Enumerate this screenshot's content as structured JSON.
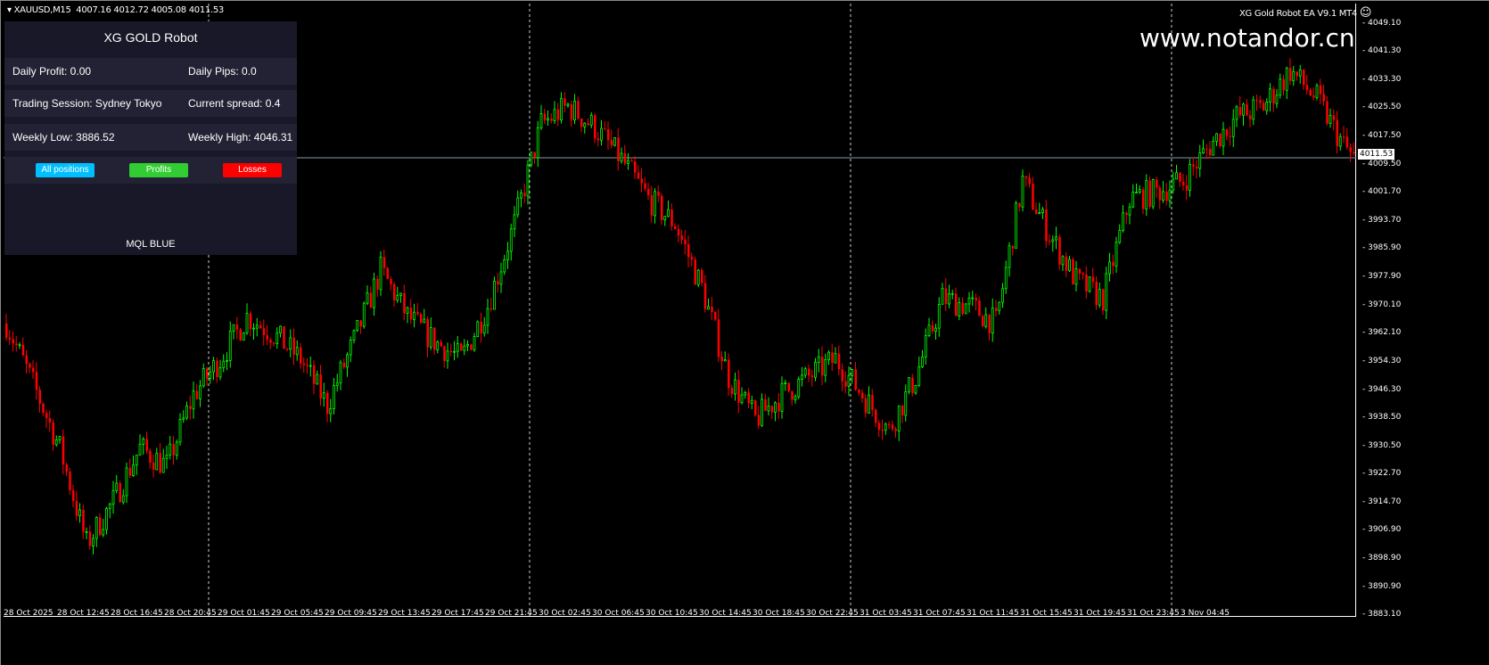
{
  "header": {
    "symbol": "XAUUSD,M15",
    "ohlc": "4007.16 4012.72 4005.08 4011.53",
    "ea_label": "XG Gold Robot EA  V9.1 MT4",
    "smiley": "☺",
    "watermark": "www.notandor.cn"
  },
  "panel": {
    "title": "XG GOLD Robot",
    "daily_profit": "Daily Profit: 0.00",
    "daily_pips": "Daily Pips:  0.0",
    "session": "Trading Session: Sydney Tokyo",
    "spread": "Current spread: 0.4",
    "weekly_low": "Weekly Low: 3886.52",
    "weekly_high": "Weekly High: 4046.31",
    "btn_all": "All positions",
    "btn_profits": "Profits",
    "btn_losses": "Losses",
    "footer": "MQL BLUE"
  },
  "colors": {
    "bull": "#00ff00",
    "bear": "#ff0000",
    "all": "#00bfff",
    "profits": "#32cd32",
    "losses": "#ff0000"
  },
  "chart_data": {
    "type": "candlestick",
    "timeframe": "M15",
    "current_price": "4011.53",
    "ylim": [
      3883.1,
      4049.1
    ],
    "price_ticks": [
      "4049.10",
      "4041.30",
      "4033.30",
      "4025.50",
      "4017.50",
      "4009.50",
      "4001.70",
      "3993.70",
      "3985.90",
      "3977.90",
      "3970.10",
      "3962.10",
      "3954.30",
      "3946.30",
      "3938.50",
      "3930.50",
      "3922.70",
      "3914.70",
      "3906.90",
      "3898.90",
      "3890.90",
      "3883.10"
    ],
    "time_ticks": [
      "28 Oct 2025",
      "28 Oct 12:45",
      "28 Oct 16:45",
      "28 Oct 20:45",
      "29 Oct 01:45",
      "29 Oct 05:45",
      "29 Oct 09:45",
      "29 Oct 13:45",
      "29 Oct 17:45",
      "29 Oct 21:45",
      "30 Oct 02:45",
      "30 Oct 06:45",
      "30 Oct 10:45",
      "30 Oct 14:45",
      "30 Oct 18:45",
      "30 Oct 22:45",
      "31 Oct 03:45",
      "31 Oct 07:45",
      "31 Oct 11:45",
      "31 Oct 15:45",
      "31 Oct 19:45",
      "31 Oct 23:45",
      "3 Nov 04:45"
    ],
    "day_separators_after_tick": [
      3,
      9,
      15,
      21
    ],
    "close_path_every_8_bars": [
      3965,
      3948,
      3930,
      3903,
      3915,
      3930,
      3925,
      3945,
      3955,
      3967,
      3962,
      3955,
      3942,
      3960,
      3980,
      3967,
      3960,
      3955,
      3970,
      3993,
      4021,
      4026,
      4020,
      4011,
      4000,
      3993,
      3975,
      3950,
      3938,
      3945,
      3950,
      3955,
      3945,
      3935,
      3950,
      3972,
      3970,
      3965,
      4005,
      3990,
      3977,
      3972,
      4000,
      4002,
      4005,
      4015,
      4023,
      4026,
      4036,
      4028,
      4015,
      4005,
      4000,
      4007,
      4015,
      4021,
      4007,
      4009,
      4031,
      4018,
      4010,
      3985,
      4005,
      4002,
      3990,
      3972,
      3997,
      4013,
      4011.53
    ]
  }
}
